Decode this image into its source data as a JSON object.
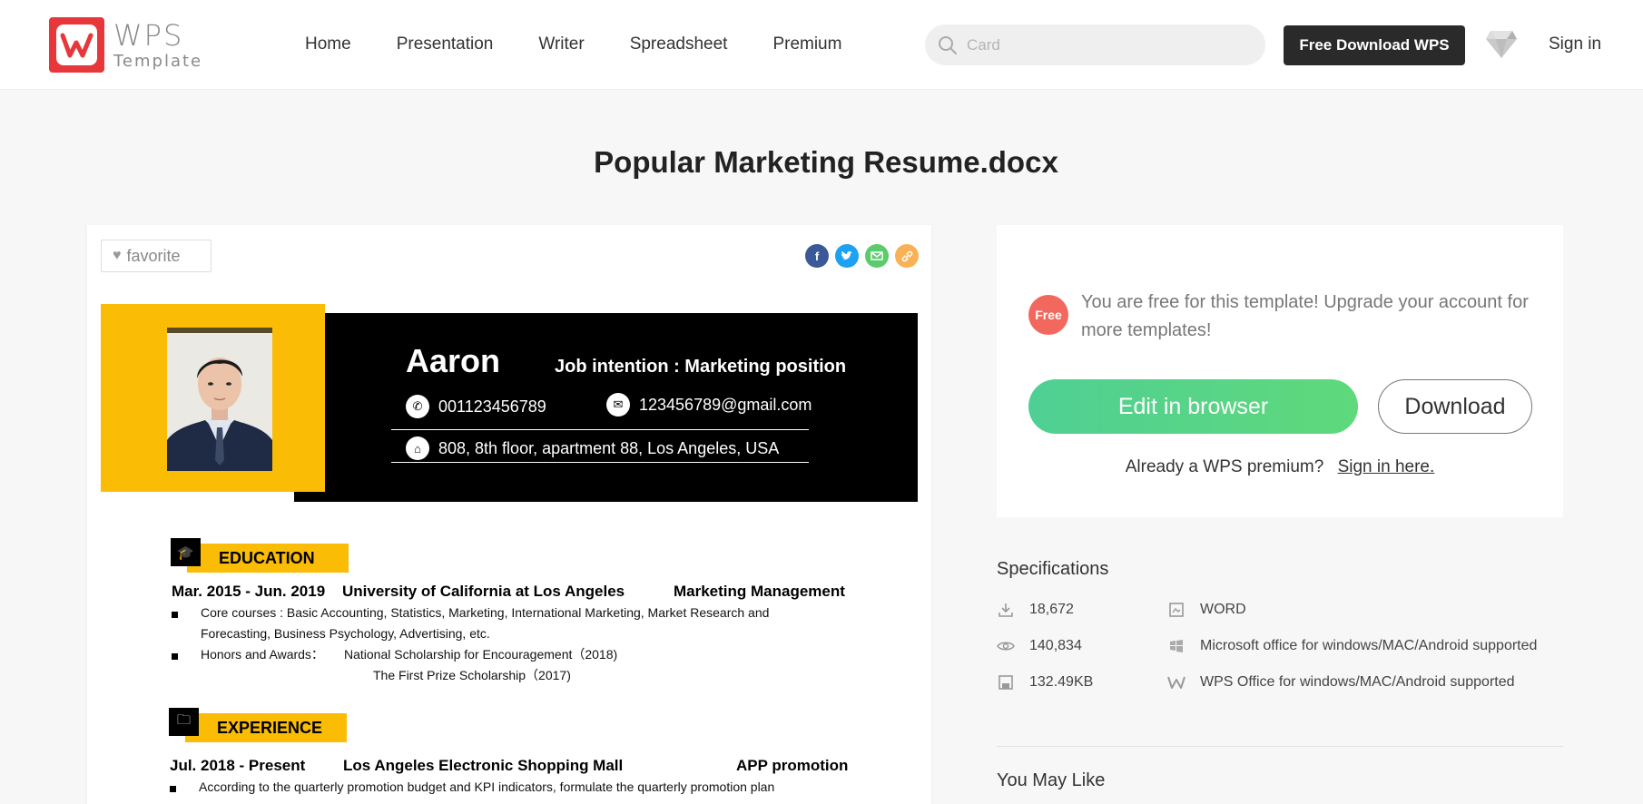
{
  "header": {
    "logo_wps": "WPS",
    "logo_sub": "Template",
    "nav": [
      "Home",
      "Presentation",
      "Writer",
      "Spreadsheet",
      "Premium"
    ],
    "search_placeholder": "Card",
    "free_download": "Free Download WPS",
    "sign_in": "Sign in"
  },
  "page_title": "Popular Marketing Resume.docx",
  "preview": {
    "favorite": "favorite",
    "share_icons": [
      "facebook-icon",
      "twitter-icon",
      "email-icon",
      "link-icon"
    ],
    "resume": {
      "name": "Aaron",
      "job": "Job intention : Marketing position",
      "phone": "001123456789",
      "email": "123456789@gmail.com",
      "address": "808, 8th floor, apartment 88, Los Angeles, USA",
      "education_title": "EDUCATION",
      "edu_dates": "Mar. 2015 - Jun. 2019",
      "edu_school": "University of California at Los Angeles",
      "edu_major": "Marketing Management",
      "edu_courses": "Core courses : Basic Accounting, Statistics, Marketing, International Marketing, Market Research and",
      "edu_courses2": "Forecasting, Business Psychology, Advertising, etc.",
      "edu_awards_label": "Honors and Awards：",
      "edu_award1": "National Scholarship for Encouragement（2018)",
      "edu_award2": "The First Prize Scholarship（2017)",
      "experience_title": "EXPERIENCE",
      "exp_dates": "Jul. 2018 - Present",
      "exp_company": "Los Angeles Electronic Shopping Mall",
      "exp_role": "APP promotion",
      "exp_bullet": "According to the quarterly promotion budget and KPI indicators, formulate the quarterly promotion plan"
    }
  },
  "sidebar": {
    "free_badge": "Free",
    "free_text": "You are free for this template! Upgrade your account for more templates!",
    "edit_button": "Edit in browser",
    "download_button": "Download",
    "premium_question": "Already a WPS premium?",
    "premium_link": "Sign in here.",
    "specs_title": "Specifications",
    "specs": {
      "downloads": "18,672",
      "format": "WORD",
      "views": "140,834",
      "office_support": "Microsoft office for windows/MAC/Android supported",
      "size": "132.49KB",
      "wps_support": "WPS Office for windows/MAC/Android supported"
    },
    "you_may_like": "You May Like"
  },
  "colors": {
    "brand_red": "#e8373b",
    "resume_yellow": "#fbbc05",
    "edit_green": "#4fcf94",
    "free_badge": "#f2685e",
    "dark_button": "#2a2a2a"
  }
}
